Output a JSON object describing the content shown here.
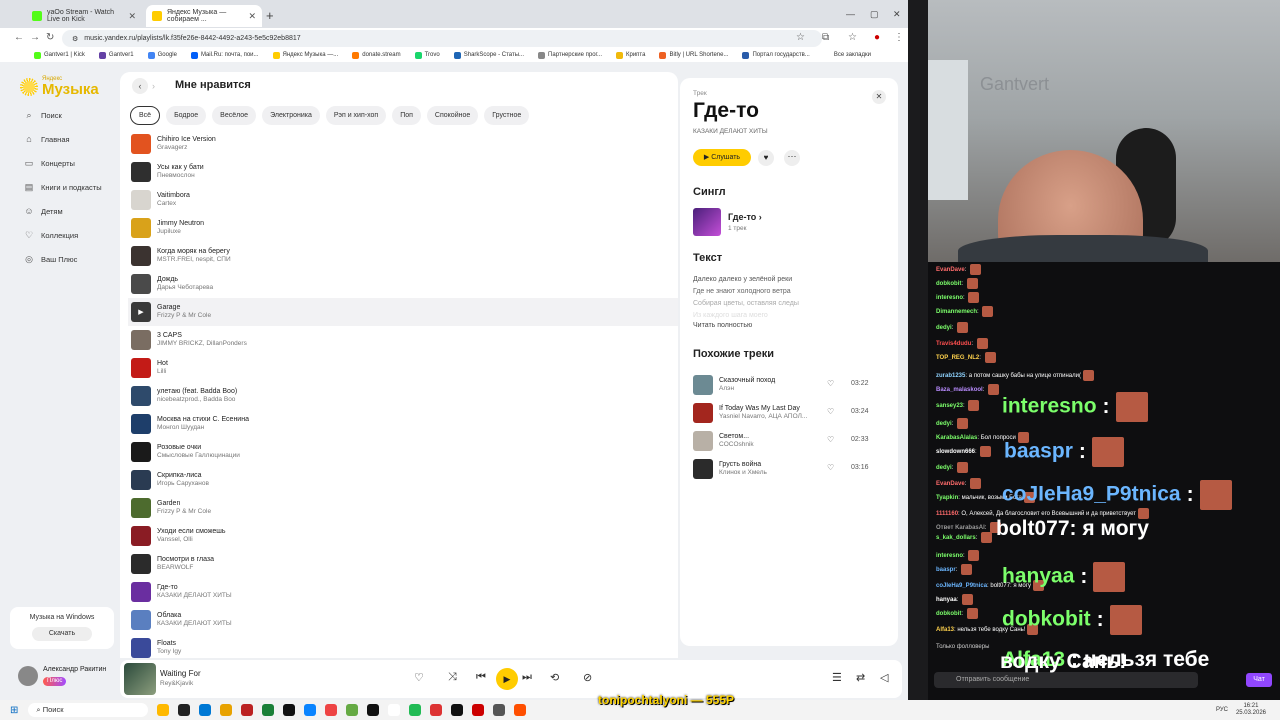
{
  "browser": {
    "tabs": [
      {
        "title": "yaOo Stream - Watch Live on Kick",
        "color": "#53fc18"
      },
      {
        "title": "Яндекс Музыка — собираем ...",
        "color": "#ffcc00"
      }
    ],
    "url": "music.yandex.ru/playlists/lk.f35fe26e-8442-4492-a243-5e5c92eb8817",
    "bookmarks": [
      {
        "label": "Gantver1 | Kick",
        "color": "#53fc18"
      },
      {
        "label": "Gantver1",
        "color": "#6441a5"
      },
      {
        "label": "Google",
        "color": "#4285f4"
      },
      {
        "label": "Mail.Ru: почта, пои...",
        "color": "#005ff9"
      },
      {
        "label": "Яндекс Музыка —...",
        "color": "#ffcc00"
      },
      {
        "label": "donate.stream",
        "color": "#ff7a00"
      },
      {
        "label": "Trovo",
        "color": "#19d66b"
      },
      {
        "label": "SharkScope - Статы...",
        "color": "#1e66b5"
      },
      {
        "label": "Партнерские прог...",
        "color": "#888888"
      },
      {
        "label": "Крипта",
        "color": "#f0b90b"
      },
      {
        "label": "Bitly | URL Shortene...",
        "color": "#ee6123"
      },
      {
        "label": "Портал государств...",
        "color": "#2a5caa"
      }
    ],
    "all_bookmarks": "Все закладки"
  },
  "sidebar": {
    "logo_small": "Яндекс",
    "logo_big": "Музыка",
    "nav": [
      {
        "label": "Поиск",
        "icon": "⌕"
      },
      {
        "label": "Главная",
        "icon": "⌂"
      },
      {
        "label": "Концерты",
        "icon": "▭"
      },
      {
        "label": "Книги и подкасты",
        "icon": "▤"
      },
      {
        "label": "Детям",
        "icon": "☺"
      },
      {
        "label": "Коллекция",
        "icon": "♡"
      },
      {
        "label": "Ваш Плюс",
        "icon": "◎"
      }
    ],
    "promo_text": "Музыка на Windows",
    "promo_button": "Скачать"
  },
  "main": {
    "title": "Мне нравится",
    "chips": [
      "Всё",
      "Бодрое",
      "Весёлое",
      "Электроника",
      "Рэп и хип-хоп",
      "Поп",
      "Спокойное",
      "Грустное"
    ],
    "tracks": [
      {
        "title": "Chihiro Ice Version",
        "artist": "Gravagerz",
        "color": "#e2531f"
      },
      {
        "title": "Усы как у бати",
        "artist": "Пневмослон",
        "color": "#2f2f2f"
      },
      {
        "title": "Vaitimbora",
        "artist": "Cartex",
        "color": "#d8d5cf"
      },
      {
        "title": "Jimmy Neutron",
        "artist": "Jupiluxe",
        "color": "#d9a21a"
      },
      {
        "title": "Когда моряк на берегу",
        "artist": "MSTR.FREI, nespit, СПИ",
        "color": "#3b3330"
      },
      {
        "title": "Дождь",
        "artist": "Дарья Чеботарева",
        "color": "#4a4a4a"
      },
      {
        "title": "Garage",
        "artist": "Frizzy P & Mr Cole",
        "color": "#3a3a3a"
      },
      {
        "title": "3 CAPS",
        "artist": "JIMMY BRICKZ, DillanPonders",
        "color": "#7a6d62"
      },
      {
        "title": "Hot",
        "artist": "Lilli",
        "color": "#c31b17"
      },
      {
        "title": "улетаю (feat. Badda Boo)",
        "artist": "nicebeatzprod., Badda Boo",
        "color": "#2e4a6b"
      },
      {
        "title": "Москва на стихи С. Есенина",
        "artist": "Монгол Шуудан",
        "color": "#1e3e6a"
      },
      {
        "title": "Розовые очки",
        "artist": "Смысловые Галлюцинации",
        "color": "#1a1a1a"
      },
      {
        "title": "Скрипка-лиса",
        "artist": "Игорь Саруханов",
        "color": "#2a3b52"
      },
      {
        "title": "Garden",
        "artist": "Frizzy P & Mr Cole",
        "color": "#4d6b2e"
      },
      {
        "title": "Уходи если сможешь",
        "artist": "Vanssel, Olli",
        "color": "#8a1c24"
      },
      {
        "title": "Посмотри в глаза",
        "artist": "BEARWOLF",
        "color": "#2b2b2b"
      },
      {
        "title": "Где-то",
        "artist": "КАЗАКИ ДЕЛАЮТ ХИТЫ",
        "color": "#6a2ea0"
      },
      {
        "title": "Облака",
        "artist": "КАЗАКИ ДЕЛАЮТ ХИТЫ",
        "color": "#5a7fc0"
      },
      {
        "title": "Floats",
        "artist": "Tony Igy",
        "color": "#3a4a9a"
      }
    ]
  },
  "panel": {
    "kind": "Трек",
    "title": "Где-то",
    "artist": "КАЗАКИ ДЕЛАЮТ ХИТЫ",
    "listen_label": "Слушать",
    "single_heading": "Сингл",
    "single_name": "Где-то",
    "single_count": "1 трек",
    "lyrics_heading": "Текст",
    "lyrics": [
      "Далеко далеко у зелёной реки",
      "Где не знают холодного ветра",
      "Собирая цветы, оставляя следы",
      "Из каждого шага моего"
    ],
    "read_all": "Читать полностью",
    "similar_heading": "Похожие треки",
    "similar": [
      {
        "title": "Сказочный поход",
        "artist": "Алэн",
        "duration": "03:22",
        "color": "#6c8a93"
      },
      {
        "title": "If Today Was My Last Day",
        "artist": "Yasniel Navarro, АЦА АПОЛ...",
        "duration": "03:24",
        "color": "#a3261e"
      },
      {
        "title": "Светом...",
        "artist": "COCOshnik",
        "duration": "02:33",
        "color": "#b8b0a6"
      },
      {
        "title": "Грусть война",
        "artist": "Клинок и Хмель",
        "duration": "03:16",
        "color": "#2b2b2b"
      }
    ]
  },
  "player": {
    "user_name": "Александр Ракитин",
    "user_badge": "Плюс",
    "track_title": "Waiting For",
    "track_artist": "Rey&Kjavik"
  },
  "taskbar": {
    "search": "Поиск",
    "lang": "РУС",
    "time": "16:21",
    "date": "25.03.2026"
  },
  "stream": {
    "cam_wall_text": "Gantvert",
    "chat": [
      {
        "user": "EvanDave",
        "color": "#ff6b6b",
        "text": ""
      },
      {
        "user": "dobkobit",
        "color": "#7cff6b",
        "text": ""
      },
      {
        "user": "interesno",
        "color": "#7cff6b",
        "text": ""
      },
      {
        "user": "Dimannemech",
        "color": "#7cff6b",
        "text": ""
      },
      {
        "user": "dedyi",
        "color": "#7cff6b",
        "text": ""
      },
      {
        "user": "Travis4dudu",
        "color": "#ff4f4f",
        "text": ""
      },
      {
        "user": "TOP_REG_NL2",
        "color": "#ffd24d",
        "text": ""
      },
      {
        "user": "zurab1235",
        "color": "#8fd3ff",
        "text": "а потом сашку бабы на улице отпинали("
      },
      {
        "user": "Baza_malaskool",
        "color": "#b98cff",
        "text": ""
      },
      {
        "user": "sansey23",
        "color": "#7cff6b",
        "text": ""
      },
      {
        "user": "dedyi",
        "color": "#7cff6b",
        "text": ""
      },
      {
        "user": "KarabasAlalas",
        "color": "#7cff6b",
        "text": "Бол попроси"
      },
      {
        "user": "slowdown666",
        "color": "#ffffff",
        "text": ""
      },
      {
        "user": "dedyi",
        "color": "#7cff6b",
        "text": ""
      },
      {
        "user": "EvanDave",
        "color": "#ff6b6b",
        "text": ""
      },
      {
        "user": "Tyapkin",
        "color": "#7cff6b",
        "text": "мальчик, возьми Бога"
      },
      {
        "user": "1111160",
        "color": "#ff6b6b",
        "text": "О, Алексей, Да благословит его Всевышний и да приветствует"
      },
      {
        "user": "Ответ KarabasAl",
        "color": "#9a9a9a",
        "text": ""
      },
      {
        "user": "s_kak_dollars",
        "color": "#7cff6b",
        "text": ""
      },
      {
        "user": "interesno",
        "color": "#7cff6b",
        "text": ""
      },
      {
        "user": "baaspr",
        "color": "#6bb6ff",
        "text": ""
      },
      {
        "user": "coJIeHa9_P9tnica",
        "color": "#6bb6ff",
        "text": "bolt077: я могу"
      },
      {
        "user": "hanyaa",
        "color": "#ffffff",
        "text": ""
      },
      {
        "user": "dobkobit",
        "color": "#7cff6b",
        "text": ""
      },
      {
        "user": "Alfa13",
        "color": "#ffd24d",
        "text": "нельзя тебе водку Сань!"
      }
    ],
    "big_lines": [
      {
        "user": "interesno",
        "color": "#7cff6b",
        "text": ":"
      },
      {
        "user": "baaspr",
        "color": "#6bb6ff",
        "text": ":"
      },
      {
        "user": "coJIeHa9_P9tnica",
        "color": "#6bb6ff",
        "text": ":"
      },
      {
        "user": "bolt077: я могу",
        "color": "#ffffff",
        "text": ""
      },
      {
        "user": "hanyaa",
        "color": "#7cff6b",
        "text": ":"
      },
      {
        "user": "dobkobit",
        "color": "#7cff6b",
        "text": ":"
      },
      {
        "user": "Alfa13",
        "color": "#7cff6b",
        "text": ": нельзя тебе"
      }
    ],
    "big_bottom": "водку Сань!",
    "followers_label": "Только фолловеры",
    "input_placeholder": "Отправить сообщение",
    "chat_button": "Чат",
    "donation": "tonipochtalyoni — 555Р"
  }
}
